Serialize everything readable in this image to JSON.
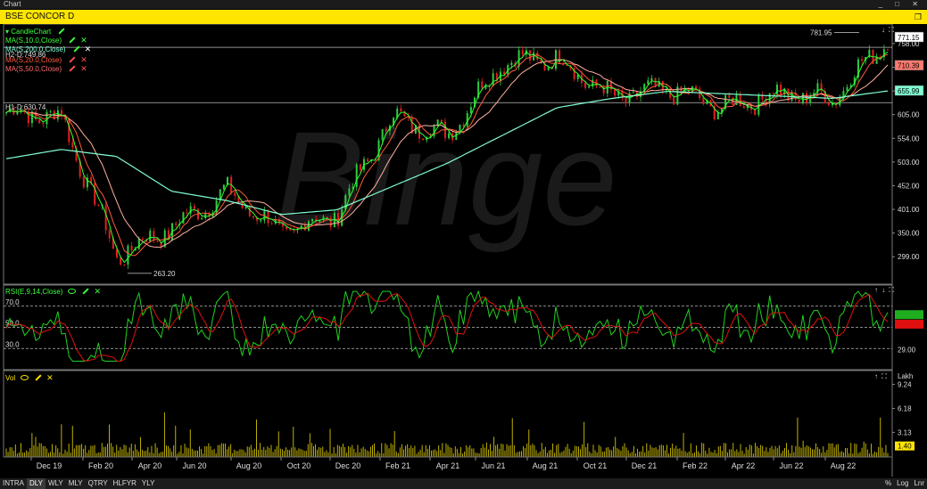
{
  "window": {
    "title": "Chart"
  },
  "chart_header": {
    "symbol_title": "BSE CONCOR D"
  },
  "indicators": {
    "candle": "CandleChart",
    "ma10": "MA(S,10.0,Close)",
    "ma200": "MA(S,200.0,Close)",
    "ma20": "MA(S,20.0,Close)",
    "ma50": "MA(S,50.0,Close)",
    "h2": "H2-D:749.86",
    "h1": "H1-D:630.74",
    "rsi": "RSI(E,9,14,Close)",
    "vol": "Vol"
  },
  "watermark": "Binge",
  "price_panel": {
    "y_ticks": [
      "758.00",
      "707.00",
      "656.00",
      "605.00",
      "554.00",
      "503.00",
      "452.00",
      "401.00",
      "350.00",
      "299.00"
    ],
    "high_label": "781.95",
    "low_label": "263.20",
    "badges": [
      {
        "text": "771.15",
        "bg": "#ffffff",
        "fg": "#000000"
      },
      {
        "text": "710.39",
        "bg": "#ff7a70",
        "fg": "#000000"
      },
      {
        "text": "655.99",
        "bg": "#7fffd4",
        "fg": "#000000"
      }
    ]
  },
  "rsi_panel": {
    "y_ticks": [
      "70.0",
      "50.0",
      "30.0"
    ],
    "right_ticks": [
      "29.00"
    ],
    "badges": [
      {
        "text": "",
        "bg": "#1fae1f"
      },
      {
        "text": "",
        "bg": "#e01010"
      }
    ]
  },
  "vol_panel": {
    "unit": "Lakh",
    "y_ticks": [
      "9.24",
      "6.18",
      "3.13"
    ],
    "badge": {
      "text": "1.40",
      "bg": "#ffe500",
      "fg": "#000000"
    }
  },
  "x_labels": [
    "Dec 19",
    "Feb 20",
    "Apr 20",
    "Jun 20",
    "Aug 20",
    "Oct 20",
    "Dec 20",
    "Feb 21",
    "Apr 21",
    "Jun 21",
    "Aug 21",
    "Oct 21",
    "Dec 21",
    "Feb 22",
    "Apr 22",
    "Jun 22",
    "Aug 22"
  ],
  "bottom_tabs": [
    "INTRA",
    "DLY",
    "WLY",
    "MLY",
    "QTRY",
    "HLFYR",
    "YLY"
  ],
  "active_tab": "DLY",
  "bottom_right": [
    "%",
    "Log",
    "Lnr"
  ],
  "colors": {
    "ma10": "#2eff2e",
    "ma200": "#7fffd4",
    "ma20": "#ff5a3c",
    "ma50": "#ffb0a0",
    "rsi": "#20d020",
    "rsi_signal": "#e01010",
    "volume": "#d4c400",
    "candle_up": "#2ecc40",
    "candle_down": "#e02020"
  },
  "chart_data": {
    "type": "line",
    "price_series": {
      "name": "CandleChart",
      "x": [
        "Dec 19",
        "Feb 20",
        "Apr 20",
        "Jun 20",
        "Aug 20",
        "Oct 20",
        "Dec 20",
        "Feb 21",
        "Apr 21",
        "Jun 21",
        "Aug 21",
        "Oct 21",
        "Dec 21",
        "Feb 22",
        "Apr 22",
        "Jun 22",
        "Aug 22"
      ],
      "values": [
        610,
        600,
        300,
        360,
        440,
        350,
        390,
        600,
        560,
        720,
        725,
        640,
        660,
        620,
        650,
        640,
        771
      ]
    },
    "ma200": [
      510,
      530,
      515,
      440,
      420,
      390,
      400,
      450,
      500,
      560,
      620,
      640,
      655,
      650,
      645,
      640,
      656
    ],
    "annotations": {
      "high": 781.95,
      "low": 263.2,
      "h2": 749.86,
      "h1": 630.74
    },
    "ylim": [
      240,
      800
    ],
    "rsi": {
      "ylim": [
        10,
        90
      ],
      "levels": [
        70,
        50,
        30
      ]
    },
    "volume": {
      "unit": "Lakh",
      "ylim": [
        0,
        11
      ]
    }
  }
}
